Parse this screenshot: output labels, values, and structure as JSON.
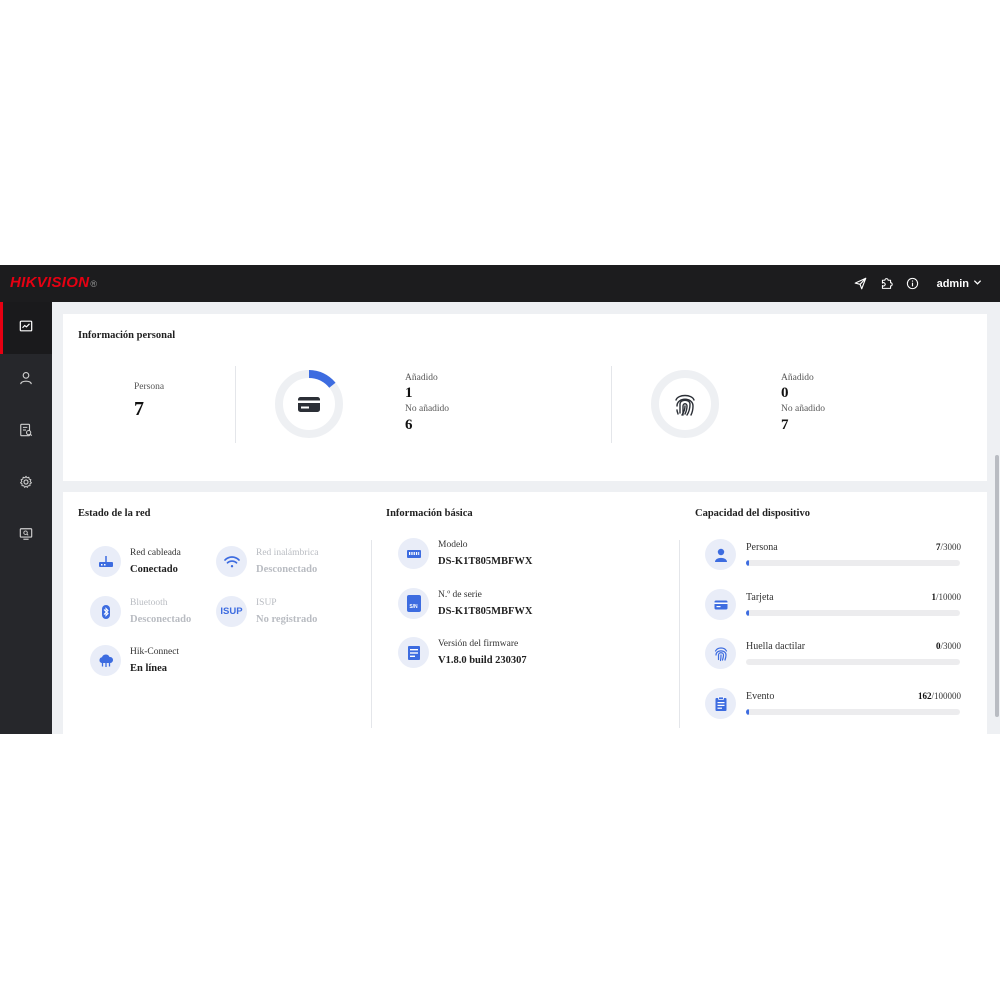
{
  "header": {
    "logo_main": "HIKVISION",
    "logo_reg": "®",
    "user_name": "admin"
  },
  "icons": {
    "topbar": [
      "send-icon",
      "puzzle-icon",
      "info-icon",
      "chevron-down-icon"
    ],
    "sidebar": [
      "dashboard-icon",
      "person-icon",
      "search-list-icon",
      "gear-icon",
      "monitor-icon"
    ]
  },
  "colors": {
    "accent": "#3d6ce0",
    "brand": "#e60012",
    "topbar": "#1c1c1e",
    "sidebar": "#26272b"
  },
  "personal": {
    "title": "Información personal",
    "persona_label": "Persona",
    "persona_count": "7",
    "card": {
      "added_label": "Añadido",
      "added": "1",
      "not_added_label": "No añadido",
      "not_added": "6",
      "added_fraction": 0.142
    },
    "fingerprint": {
      "added_label": "Añadido",
      "added": "0",
      "not_added_label": "No añadido",
      "not_added": "7",
      "added_fraction": 0
    }
  },
  "network": {
    "title": "Estado de la red",
    "items": [
      {
        "label": "Red cableada",
        "value": "Conectado",
        "icon": "wired-network-icon",
        "enabled": true
      },
      {
        "label": "Red inalámbrica",
        "value": "Desconectado",
        "icon": "wifi-icon",
        "enabled": false
      },
      {
        "label": "Bluetooth",
        "value": "Desconectado",
        "icon": "bluetooth-icon",
        "enabled": false
      },
      {
        "label": "ISUP",
        "value": "No registrado",
        "icon": "isup-icon",
        "enabled": false,
        "icon_text": "ISUP"
      },
      {
        "label": "Hik-Connect",
        "value": "En línea",
        "icon": "cloud-icon",
        "enabled": true
      }
    ]
  },
  "basic": {
    "title": "Información básica",
    "items": [
      {
        "label": "Modelo",
        "value": "DS-K1T805MBFWX",
        "icon": "device-model-icon"
      },
      {
        "label": "N.º de serie",
        "value": "DS-K1T805MBFWX",
        "icon": "serial-number-icon",
        "icon_text": "S/N"
      },
      {
        "label": "Versión del firmware",
        "value": "V1.8.0 build 230307",
        "icon": "firmware-icon"
      }
    ]
  },
  "capacity": {
    "title": "Capacidad del dispositivo",
    "items": [
      {
        "label": "Persona",
        "used": "7",
        "total": "/3000",
        "fraction": 0.0023,
        "icon": "person-icon"
      },
      {
        "label": "Tarjeta",
        "used": "1",
        "total": "/10000",
        "fraction": 0.0001,
        "icon": "card-icon"
      },
      {
        "label": "Huella dactilar",
        "used": "0",
        "total": "/3000",
        "fraction": 0,
        "icon": "fingerprint-icon"
      },
      {
        "label": "Evento",
        "used": "162",
        "total": "/100000",
        "fraction": 0.0016,
        "icon": "event-log-icon"
      }
    ]
  }
}
